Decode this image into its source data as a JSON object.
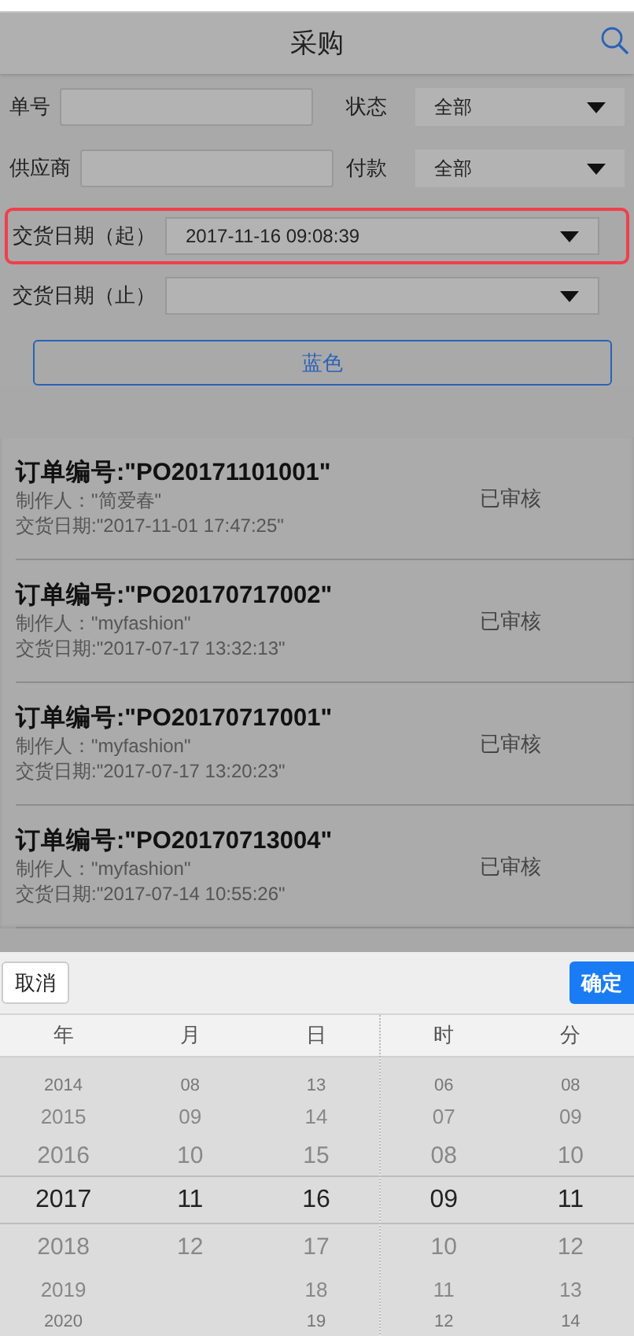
{
  "header": {
    "title": "采购"
  },
  "filters": [
    {
      "kind": "input",
      "label": "单号"
    },
    {
      "kind": "select",
      "label": "状态",
      "value": "全部"
    },
    {
      "kind": "input",
      "label": "供应商"
    },
    {
      "kind": "select",
      "label": "付款",
      "value": "全部"
    },
    {
      "kind": "date",
      "label": "交货日期（起）",
      "value": "2017-11-16 09:08:39",
      "highlighted": true
    },
    {
      "kind": "date",
      "label": "交货日期（止）",
      "highlighted": false
    }
  ],
  "search_button": "蓝色",
  "orders": [
    {
      "title": "订单编号:\"PO20171101001\"",
      "maker": "制作人：\"简爱春\"",
      "date": "交货日期:\"2017-11-01 17:47:25\"",
      "status": "已审核"
    },
    {
      "title": "订单编号:\"PO20170717002\"",
      "maker": "制作人：\"myfashion\"",
      "date": "交货日期:\"2017-07-17 13:32:13\"",
      "status": "已审核"
    },
    {
      "title": "订单编号:\"PO20170717001\"",
      "maker": "制作人：\"myfashion\"",
      "date": "交货日期:\"2017-07-17 13:20:23\"",
      "status": "已审核"
    },
    {
      "title": "订单编号:\"PO20170713004\"",
      "maker": "制作人：\"myfashion\"",
      "date": "交货日期:\"2017-07-14 10:55:26\"",
      "status": "已审核"
    }
  ],
  "picker": {
    "cancel": "取消",
    "confirm": "确定",
    "columns": [
      {
        "heading": "年",
        "items": [
          {
            "text": "2014",
            "selected": false
          },
          {
            "text": "2015",
            "selected": false
          },
          {
            "text": "2016",
            "selected": false
          },
          {
            "text": "2017",
            "selected": true
          },
          {
            "text": "2018",
            "selected": false
          },
          {
            "text": "2019",
            "selected": false
          },
          {
            "text": "2020",
            "selected": false
          }
        ]
      },
      {
        "heading": "月",
        "items": [
          {
            "text": "08",
            "selected": false
          },
          {
            "text": "09",
            "selected": false
          },
          {
            "text": "10",
            "selected": false
          },
          {
            "text": "11",
            "selected": true
          },
          {
            "text": "12",
            "selected": false
          }
        ]
      },
      {
        "heading": "日",
        "items": [
          {
            "text": "13",
            "selected": false
          },
          {
            "text": "14",
            "selected": false
          },
          {
            "text": "15",
            "selected": false
          },
          {
            "text": "16",
            "selected": true
          },
          {
            "text": "17",
            "selected": false
          },
          {
            "text": "18",
            "selected": false
          },
          {
            "text": "19",
            "selected": false
          }
        ]
      },
      {
        "heading": "时",
        "items": [
          {
            "text": "06",
            "selected": false
          },
          {
            "text": "07",
            "selected": false
          },
          {
            "text": "08",
            "selected": false
          },
          {
            "text": "09",
            "selected": true
          },
          {
            "text": "10",
            "selected": false
          },
          {
            "text": "11",
            "selected": false
          },
          {
            "text": "12",
            "selected": false
          }
        ]
      },
      {
        "heading": "分",
        "items": [
          {
            "text": "08",
            "selected": false
          },
          {
            "text": "09",
            "selected": false
          },
          {
            "text": "10",
            "selected": false
          },
          {
            "text": "11",
            "selected": true
          },
          {
            "text": "12",
            "selected": false
          },
          {
            "text": "13",
            "selected": false
          },
          {
            "text": "14",
            "selected": false
          }
        ]
      }
    ]
  }
}
